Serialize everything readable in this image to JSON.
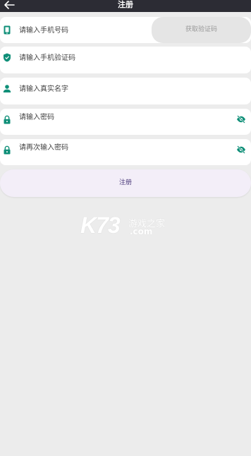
{
  "appbar": {
    "title": "注册",
    "back_icon": "arrow-left-icon"
  },
  "form": {
    "phone": {
      "placeholder": "请输入手机号码",
      "icon": "mobile-phone-icon"
    },
    "get_code_label": "获取验证码",
    "code": {
      "placeholder": "请输入手机验证码",
      "icon": "shield-icon"
    },
    "name": {
      "placeholder": "请输入真实名字",
      "icon": "person-icon"
    },
    "password": {
      "placeholder": "请输入密码",
      "icon": "lock-icon",
      "toggle_icon": "eye-off-icon"
    },
    "password_confirm": {
      "placeholder": "请再次输入密码",
      "icon": "lock-icon",
      "toggle_icon": "eye-off-icon"
    },
    "submit_label": "注册"
  },
  "watermark": {
    "brand": "K73",
    "cn": "游戏之家",
    "domain": ".com"
  },
  "colors": {
    "appbar": "#2c2c34",
    "icon_accent": "#0f8f78",
    "background": "#ececec",
    "submit_bg": "#f3eef8",
    "code_btn_bg": "#e5e5e5"
  }
}
